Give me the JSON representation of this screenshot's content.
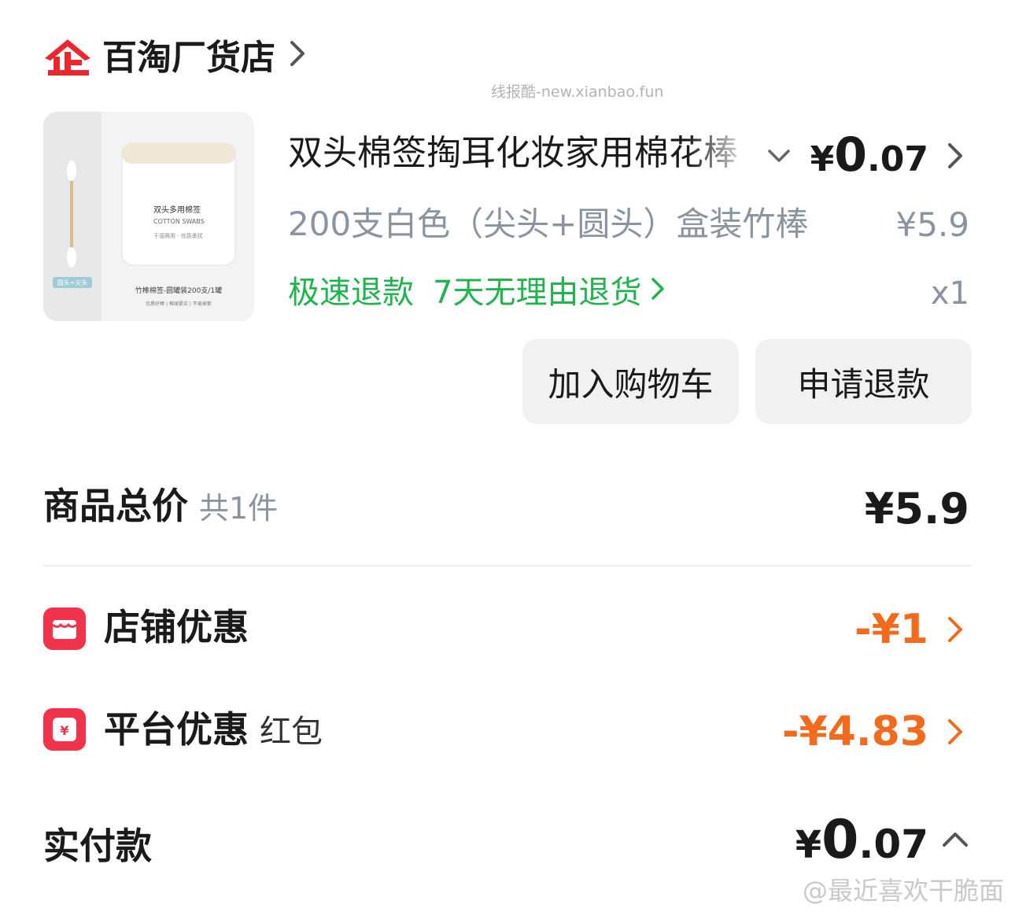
{
  "shop": {
    "name": "百淘厂货店",
    "logo_text": "企"
  },
  "watermark_top": "线报酷-new.xianbao.fun",
  "product": {
    "title": "双头棉签掏耳化妆家用棉花棒",
    "spec": "200支白色（尖头+圆头）盒装竹棒",
    "services": [
      "极速退款",
      "7天无理由退货"
    ],
    "price_prefix": "¥",
    "price_int": "0",
    "price_dec": ".07",
    "original_price": "¥5.9",
    "quantity": "x1",
    "image": {
      "title_cn": "双头多用棉签",
      "title_en": "COTTON SWABS",
      "line": "干湿两用 · 优质承拭",
      "caption": "竹棒棉签-圆罐装200支/1罐",
      "tag": "圆头+尖头",
      "bullets": "优质好棒 | 棉球紧实 | 不易掉絮"
    }
  },
  "actions": {
    "add_cart": "加入购物车",
    "refund": "申请退款"
  },
  "summary": {
    "total_label": "商品总价",
    "total_count": "共1件",
    "total_value": "¥5.9",
    "shop_discount_label": "店铺优惠",
    "shop_discount_value": "-¥1",
    "platform_discount_label": "平台优惠",
    "platform_discount_sub": "红包",
    "platform_discount_value": "-¥4.83",
    "pay_label": "实付款",
    "pay_prefix": "¥",
    "pay_int": "0",
    "pay_dec": ".07"
  },
  "watermark_bottom": "@最近喜欢干脆面",
  "colors": {
    "accent_red": "#e8272e",
    "discount_orange": "#f26a1b",
    "service_green": "#22b34f",
    "muted": "#8a93a0"
  }
}
